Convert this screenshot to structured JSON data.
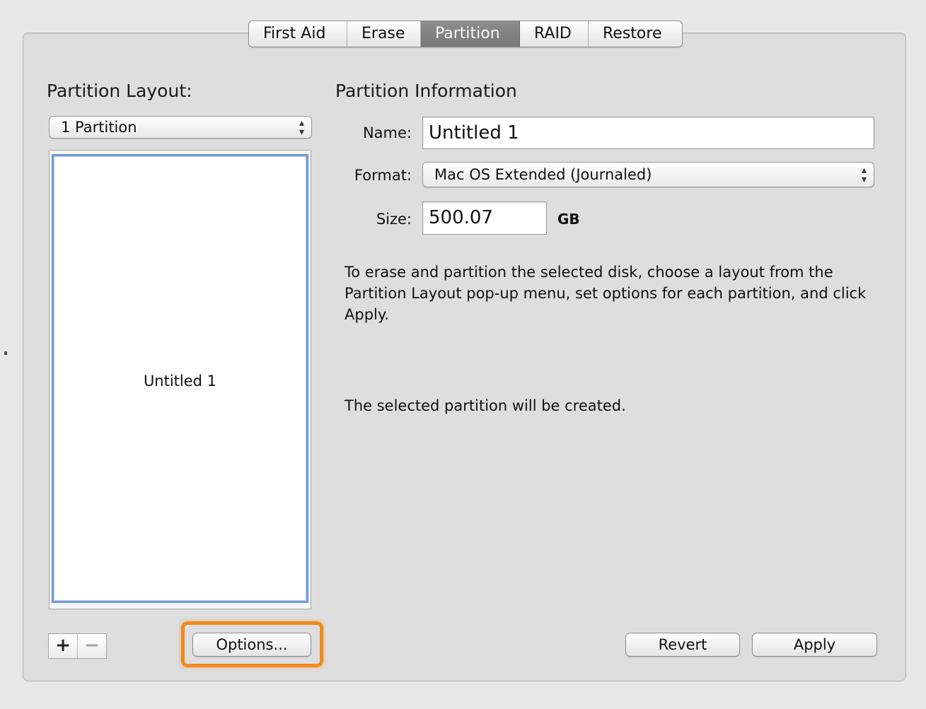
{
  "tabs": [
    {
      "label": "First Aid",
      "selected": false
    },
    {
      "label": "Erase",
      "selected": false
    },
    {
      "label": "Partition",
      "selected": true
    },
    {
      "label": "RAID",
      "selected": false
    },
    {
      "label": "Restore",
      "selected": false
    }
  ],
  "layout": {
    "heading": "Partition Layout:",
    "popup_value": "1 Partition",
    "partitions": [
      {
        "name": "Untitled 1"
      }
    ],
    "add_label": "+",
    "remove_label": "−",
    "options_label": "Options..."
  },
  "info": {
    "heading": "Partition Information",
    "name_label": "Name:",
    "name_value": "Untitled 1",
    "format_label": "Format:",
    "format_value": "Mac OS Extended (Journaled)",
    "size_label": "Size:",
    "size_value": "500.07",
    "size_unit": "GB",
    "instructions": "To erase and partition the selected disk, choose a layout from the Partition Layout pop-up menu, set options for each partition, and click Apply.",
    "status": "The selected partition will be created."
  },
  "buttons": {
    "revert": "Revert",
    "apply": "Apply"
  },
  "colors": {
    "highlight": "#f08a1c",
    "selection_border": "#6f9ad8",
    "selected_tab": "#808080"
  }
}
